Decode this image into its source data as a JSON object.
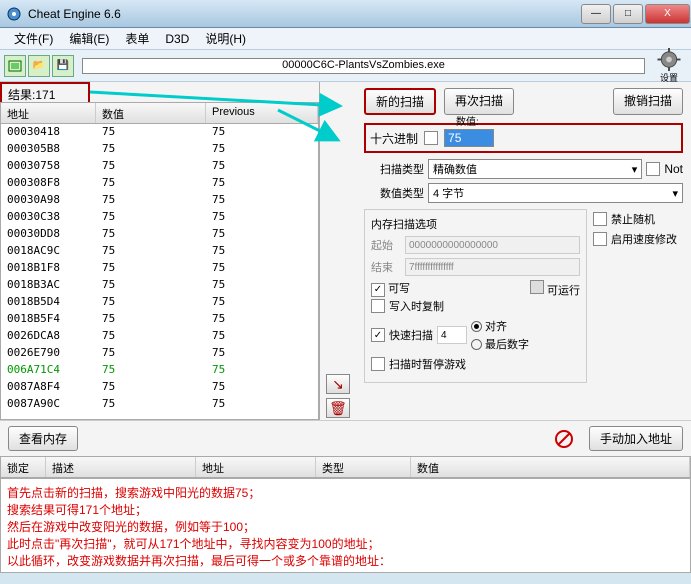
{
  "window": {
    "title": "Cheat Engine 6.6",
    "minimize": "—",
    "maximize": "□",
    "close": "X"
  },
  "menu": {
    "file": "文件(F)",
    "edit": "编辑(E)",
    "table": "表单",
    "d3d": "D3D",
    "help": "说明(H)"
  },
  "toolbar": {
    "open_icon": "📂",
    "save_icon": "💾",
    "process_name": "00000C6C-PlantsVsZombies.exe",
    "settings": "设置"
  },
  "results": {
    "label_prefix": "结果:",
    "count": "171",
    "headers": {
      "addr": "地址",
      "value": "数值",
      "prev": "Previous"
    },
    "rows": [
      {
        "a": "00030418",
        "v": "75",
        "p": "75",
        "g": false
      },
      {
        "a": "000305B8",
        "v": "75",
        "p": "75",
        "g": false
      },
      {
        "a": "00030758",
        "v": "75",
        "p": "75",
        "g": false
      },
      {
        "a": "000308F8",
        "v": "75",
        "p": "75",
        "g": false
      },
      {
        "a": "00030A98",
        "v": "75",
        "p": "75",
        "g": false
      },
      {
        "a": "00030C38",
        "v": "75",
        "p": "75",
        "g": false
      },
      {
        "a": "00030DD8",
        "v": "75",
        "p": "75",
        "g": false
      },
      {
        "a": "0018AC9C",
        "v": "75",
        "p": "75",
        "g": false
      },
      {
        "a": "0018B1F8",
        "v": "75",
        "p": "75",
        "g": false
      },
      {
        "a": "0018B3AC",
        "v": "75",
        "p": "75",
        "g": false
      },
      {
        "a": "0018B5D4",
        "v": "75",
        "p": "75",
        "g": false
      },
      {
        "a": "0018B5F4",
        "v": "75",
        "p": "75",
        "g": false
      },
      {
        "a": "0026DCA8",
        "v": "75",
        "p": "75",
        "g": false
      },
      {
        "a": "0026E790",
        "v": "75",
        "p": "75",
        "g": false
      },
      {
        "a": "006A71C4",
        "v": "75",
        "p": "75",
        "g": true
      },
      {
        "a": "0087A8F4",
        "v": "75",
        "p": "75",
        "g": false
      },
      {
        "a": "0087A90C",
        "v": "75",
        "p": "75",
        "g": false
      }
    ]
  },
  "scan": {
    "new_scan": "新的扫描",
    "next_scan": "再次扫描",
    "undo_scan": "撤销扫描",
    "value_header": "数值:",
    "hex": "十六进制",
    "value": "75",
    "scan_type_label": "扫描类型",
    "scan_type": "精确数值",
    "not": "Not",
    "value_type_label": "数值类型",
    "value_type": "4 字节",
    "mem_options_title": "内存扫描选项",
    "start_label": "起始",
    "start": "0000000000000000",
    "end_label": "结束",
    "end": "7fffffffffffffff",
    "writable": "可写",
    "runnable": "可运行",
    "copy_on_write": "写入时复制",
    "fast_scan": "快速扫描",
    "fast_scan_value": "4",
    "aligned": "对齐",
    "last_digit": "最后数字",
    "pause_on_scan": "扫描时暂停游戏",
    "disable_random": "禁止随机",
    "enable_speed": "启用速度修改"
  },
  "bottom": {
    "view_mem": "查看内存",
    "manual_add": "手动加入地址"
  },
  "lock_header": {
    "lock": "锁定",
    "desc": "描述",
    "addr": "地址",
    "type": "类型",
    "value": "数值"
  },
  "tutorial": {
    "l1": "首先点击新的扫描，搜索游戏中阳光的数据75；",
    "l2": "搜索结果可得171个地址；",
    "l3": "然后在游戏中改变阳光的数据，例如等于100；",
    "l4": "此时点击\"再次扫描\"，就可从171个地址中，寻找内容变为100的地址；",
    "l5": "以此循环，改变游戏数据并再次扫描，最后可得一个或多个靠谱的地址："
  }
}
